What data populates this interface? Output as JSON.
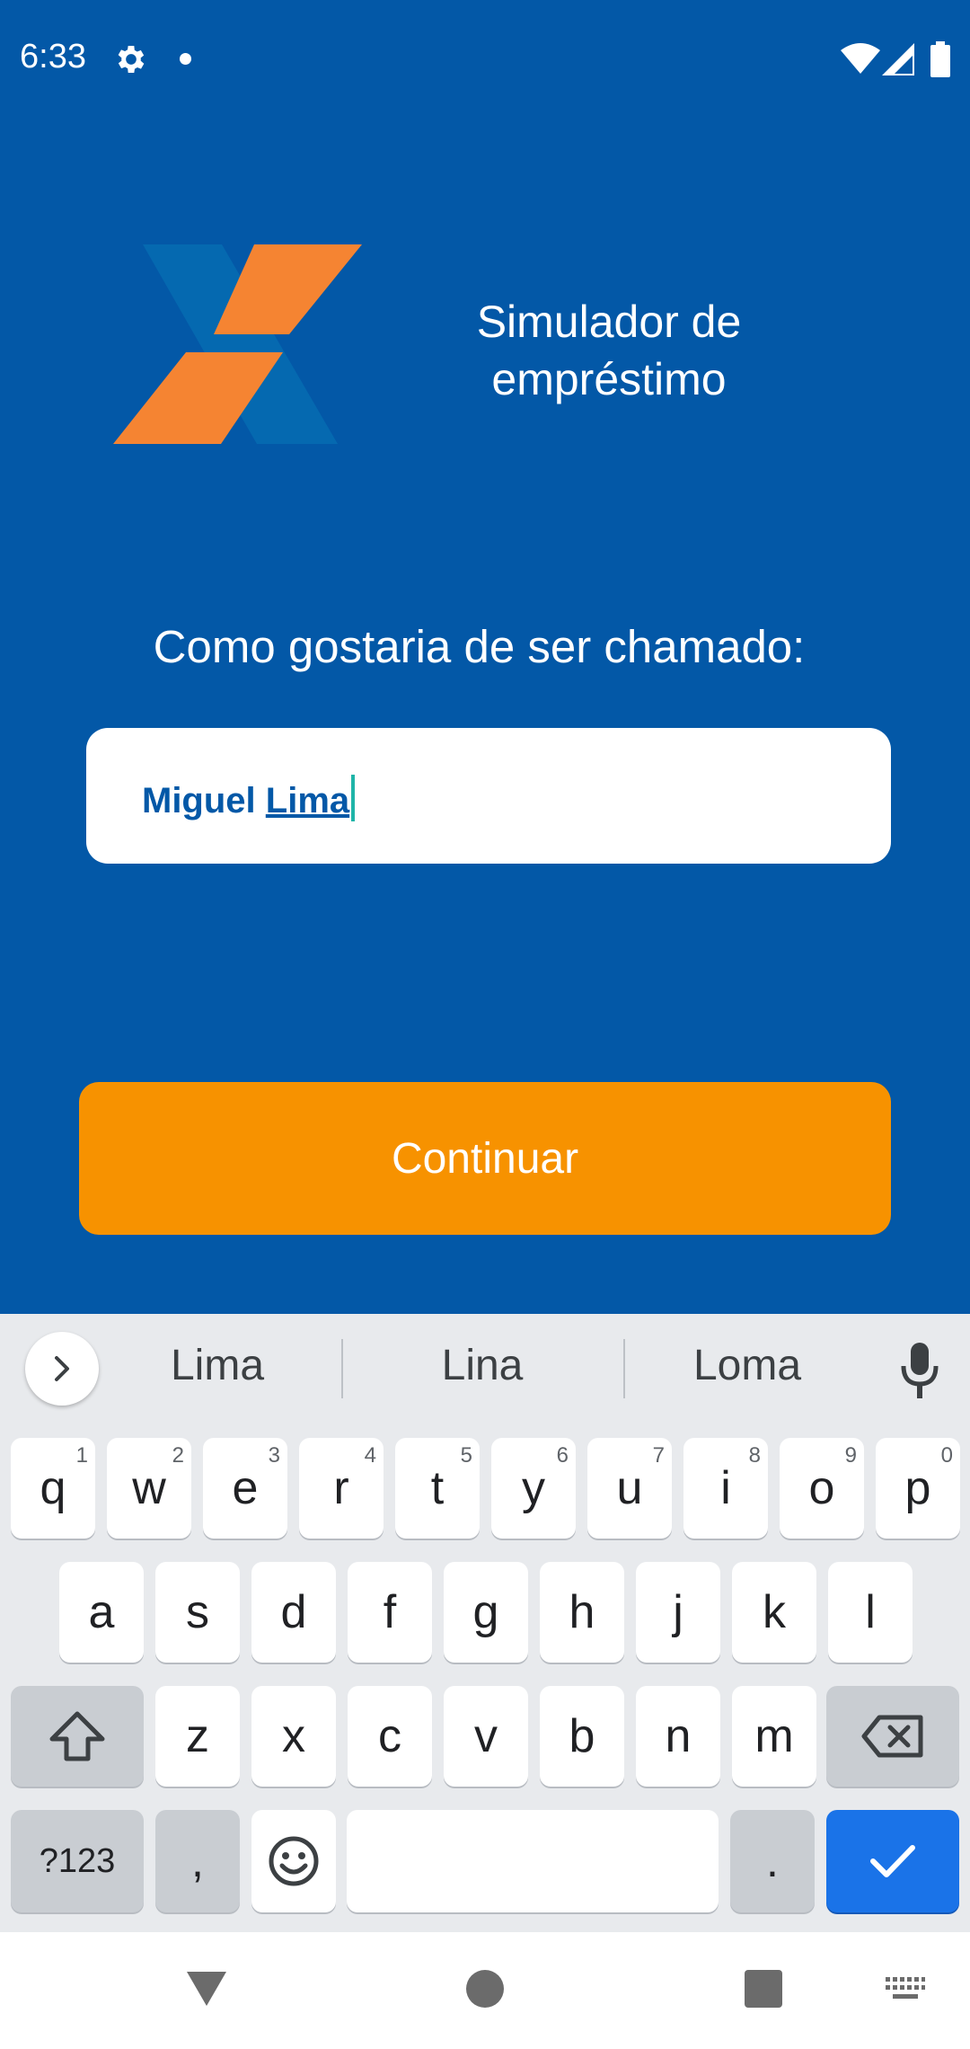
{
  "status_bar": {
    "time": "6:33",
    "icons": [
      "settings-gear-icon",
      "notification-dot-icon",
      "wifi-icon",
      "cell-signal-icon",
      "battery-icon"
    ]
  },
  "app": {
    "title": "Simulador de empréstimo",
    "logo": "caixa-x-logo",
    "brand_colors": {
      "background": "#0358A7",
      "accent": "#F79200",
      "logo_orange": "#F58432",
      "logo_blue": "#0569B0"
    }
  },
  "form": {
    "prompt": "Como gostaria de ser chamado:",
    "name_value_first": "Miguel ",
    "name_value_composing": "Lima",
    "continue_label": "Continuar"
  },
  "keyboard": {
    "suggestions": [
      "Lima",
      "Lina",
      "Loma"
    ],
    "row1": [
      {
        "k": "q",
        "h": "1"
      },
      {
        "k": "w",
        "h": "2"
      },
      {
        "k": "e",
        "h": "3"
      },
      {
        "k": "r",
        "h": "4"
      },
      {
        "k": "t",
        "h": "5"
      },
      {
        "k": "y",
        "h": "6"
      },
      {
        "k": "u",
        "h": "7"
      },
      {
        "k": "i",
        "h": "8"
      },
      {
        "k": "o",
        "h": "9"
      },
      {
        "k": "p",
        "h": "0"
      }
    ],
    "row2": [
      "a",
      "s",
      "d",
      "f",
      "g",
      "h",
      "j",
      "k",
      "l"
    ],
    "row3": [
      "z",
      "x",
      "c",
      "v",
      "b",
      "n",
      "m"
    ],
    "symbols_label": "?123",
    "comma_label": ",",
    "period_label": ".",
    "enter_color": "#1A73E8"
  },
  "nav_bar": {
    "icons": [
      "back-triangle-icon",
      "home-circle-icon",
      "recents-square-icon",
      "keyboard-switch-icon"
    ]
  }
}
